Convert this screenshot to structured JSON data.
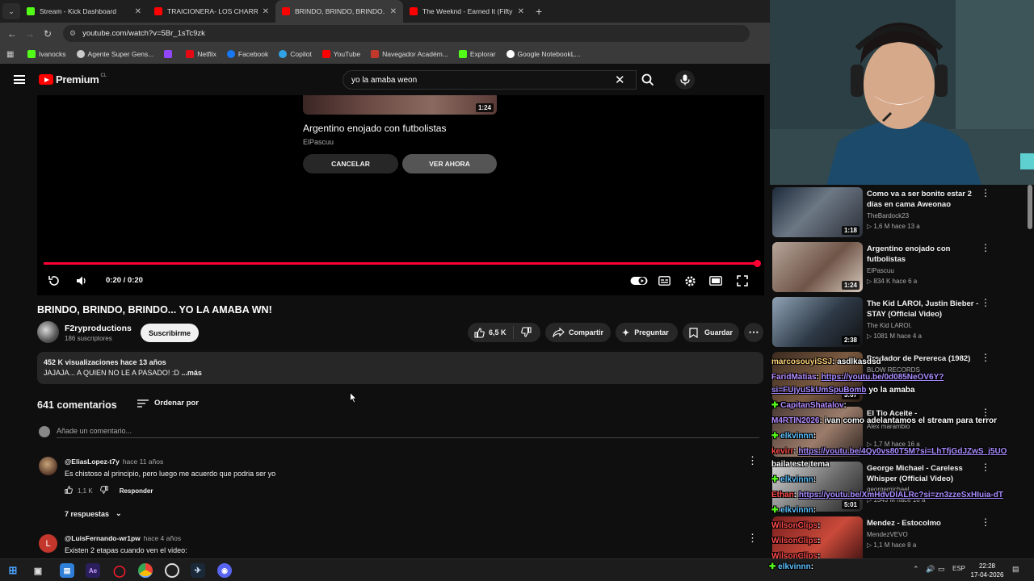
{
  "browser": {
    "tabs": [
      {
        "title": "Stream - Kick Dashboard",
        "color": "#53fc18"
      },
      {
        "title": "TRAICIONERA- LOS CHARROS DE",
        "color": "#ff0000"
      },
      {
        "title": "BRINDO, BRINDO, BRINDO... YO",
        "color": "#ff0000"
      },
      {
        "title": "The Weeknd - Earned It (Fifty Sh",
        "color": "#ff0000"
      }
    ],
    "url": "youtube.com/watch?v=5Br_1sTc9zk",
    "bookmarks": [
      {
        "label": "Ivanocks",
        "color": "#53fc18"
      },
      {
        "label": "Agente Super Gens...",
        "color": "#cccccc"
      },
      {
        "label": "",
        "color": "#9146ff"
      },
      {
        "label": "Netflix",
        "color": "#e50914"
      },
      {
        "label": "Facebook",
        "color": "#1877f2"
      },
      {
        "label": "Copilot",
        "color": "#2fa3e6"
      },
      {
        "label": "YouTube",
        "color": "#ff0000"
      },
      {
        "label": "Navegador Académ...",
        "color": "#c0392b"
      },
      {
        "label": "Explorar",
        "color": "#53fc18"
      },
      {
        "label": "Google NotebookL...",
        "color": "#ffffff"
      }
    ]
  },
  "youtube": {
    "logo_text": "Premium",
    "logo_region": "CL",
    "search_query": "yo la amaba weon"
  },
  "player": {
    "next_title": "Argentino enojado con futbolistas",
    "next_channel": "ElPascuu",
    "next_duration": "1:24",
    "cancel_label": "CANCELAR",
    "watch_label": "VER AHORA",
    "timecode": "0:20 / 0:20",
    "progress": 1.0
  },
  "video": {
    "title": "BRINDO, BRINDO, BRINDO... YO LA AMABA WN!",
    "channel": "F2ryproductions",
    "subscribers": "186 suscriptores",
    "subscribe_label": "Suscribirme",
    "likes": "6,5 K",
    "share_label": "Compartir",
    "ask_label": "Preguntar",
    "save_label": "Guardar",
    "stats": "452 K visualizaciones  hace 13 años",
    "description": "JAJAJA... A QUIEN NO LE A PASADO! :D ",
    "more_label": "...más"
  },
  "comments": {
    "count": "641 comentarios",
    "sort_label": "Ordenar por",
    "placeholder": "Añade un comentario...",
    "items": [
      {
        "author": "@EliasLopez-t7y",
        "time": "hace 11 años",
        "text": "Es chistoso al principio, pero luego me acuerdo que podria ser yo",
        "likes": "1,1 K",
        "reply_label": "Responder",
        "replies": "7 respuestas"
      },
      {
        "author": "@LuisFernando-wr1pw",
        "time": "hace 4 años",
        "text": "Existen 2 etapas cuando ven el video:",
        "avatar_letter": "L"
      }
    ]
  },
  "recommendations": [
    {
      "title": "Como va a ser bonito estar 2 días en cama Aweonao",
      "channel": "TheBardock23",
      "meta": "▷ 1,6 M  hace 13 a",
      "duration": "1:18"
    },
    {
      "title": "Argentino enojado con futbolistas",
      "channel": "ElPascuu",
      "meta": "▷ 834 K  hace 6 a",
      "duration": "1:24"
    },
    {
      "title": "The Kid LAROI, Justin Bieber - STAY (Official Video)",
      "channel": "The Kid LAROI.",
      "meta": "▷ 1081 M  hace 4 a",
      "duration": "2:38"
    },
    {
      "title": "Predador de Perereca (1982)",
      "channel": "BLOW RECORDS",
      "meta": "",
      "duration": "3:07"
    },
    {
      "title": "El Tio Aceite -",
      "channel": "Alex marambio",
      "meta": "▷ 1,7 M  hace 16 a",
      "duration": ""
    },
    {
      "title": "George Michael - Careless Whisper (Official Video)",
      "channel": "georgemichael",
      "meta": "▷ 1543 M  hace 16 a",
      "duration": "5:01"
    },
    {
      "title": "Mendez - Estocolmo",
      "channel": "MendezVEVO",
      "meta": "▷ 1,1 M  hace 8 a",
      "duration": ""
    }
  ],
  "chat": [
    {
      "user": "marcosouyiSSJ",
      "text": "asdlkasdsd"
    },
    {
      "user": "FaridMatias",
      "text": "https://youtu.be/0d085NeOV6Y?"
    },
    {
      "user": "",
      "text": "si=FUjyuSkUmSpuBomb",
      "suffix": "yo la amaba"
    },
    {
      "user": "CapitanShatalov",
      "text": ""
    },
    {
      "user": "M4RTIN2026",
      "text": "ivan como adelantamos el stream para terror"
    },
    {
      "user": "elkvinnn",
      "text": ""
    },
    {
      "user": "kevirr",
      "text": "https://youtu.be/4Qy0vs80T5M?si=LhTfjGdJZwS_j5UO"
    },
    {
      "user": "",
      "text": "baila este tema"
    },
    {
      "user": "elkvinnn",
      "text": ""
    },
    {
      "user": "Ethan",
      "text": "https://youtu.be/XmHdvDIALRc?si=zn3zzeSxHIuia-dT"
    },
    {
      "user": "elkvinnn",
      "text": ""
    },
    {
      "user": "WilsonClips",
      "text": ""
    },
    {
      "user": "WilsonClips",
      "text": ""
    },
    {
      "user": "WilsonClips",
      "text": ""
    },
    {
      "user": "elkvinnn",
      "text": ""
    }
  ],
  "taskbar": {
    "lang": "ESP",
    "time": "22:28",
    "date": "17-04-2026"
  }
}
